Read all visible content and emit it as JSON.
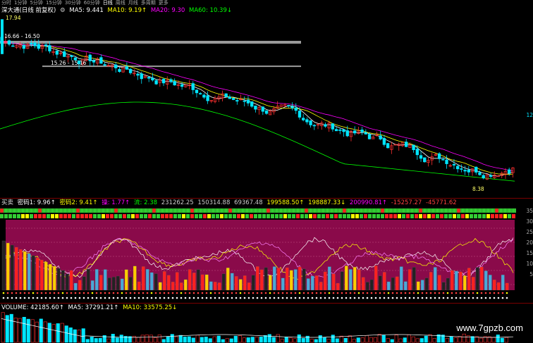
{
  "tabs": [
    "分时",
    "1分钟",
    "5分钟",
    "15分钟",
    "30分钟",
    "60分钟",
    "日线",
    "周线",
    "月线",
    "多周期",
    "更多"
  ],
  "active_tab": 6,
  "header": {
    "stock": "深大通(日线 前复权)",
    "ma5": "MA5: 9.441",
    "ma10": "MA10: 9.19↑",
    "ma20": "MA20: 9.30",
    "ma60": "MA60: 10.39↓"
  },
  "price_labels": {
    "high": "17.94",
    "band1": "16.66 - 16.50",
    "band2": "15.26 - 15.16",
    "low": "8.38",
    "right_marker": "12"
  },
  "indicator": {
    "name": "买卖",
    "code1": "密码1: 9.96↑",
    "code2": "密码2: 9.41↑",
    "cao": "操: 1.77↑",
    "liu": "流: 2.38",
    "v1": "231262.25",
    "v2": "150314.88",
    "v3": "69367.48",
    "v4": "199588.50↑",
    "v5": "198887.33↓",
    "v6": "200990.81↑",
    "v7": "-15257.27",
    "v8": "-45771.62",
    "right_ticks": [
      "35",
      "30",
      "25",
      "20",
      "15",
      "10",
      "5"
    ],
    "right_top": "35"
  },
  "volume": {
    "label": "VOLUME: 42185.60↑",
    "ma5": "MA5: 37291.21↑",
    "ma10": "MA10: 33575.25↓"
  },
  "watermark": "www.7gpzb.com",
  "colors": {
    "up": "#ff3030",
    "down": "#00e5ff",
    "ma5": "#ffffff",
    "ma10": "#ffff00",
    "ma20": "#ff00ff",
    "ma60": "#00ff00",
    "panel_bg": "#8a0a4a",
    "green_box": "#3ccc3c"
  }
}
